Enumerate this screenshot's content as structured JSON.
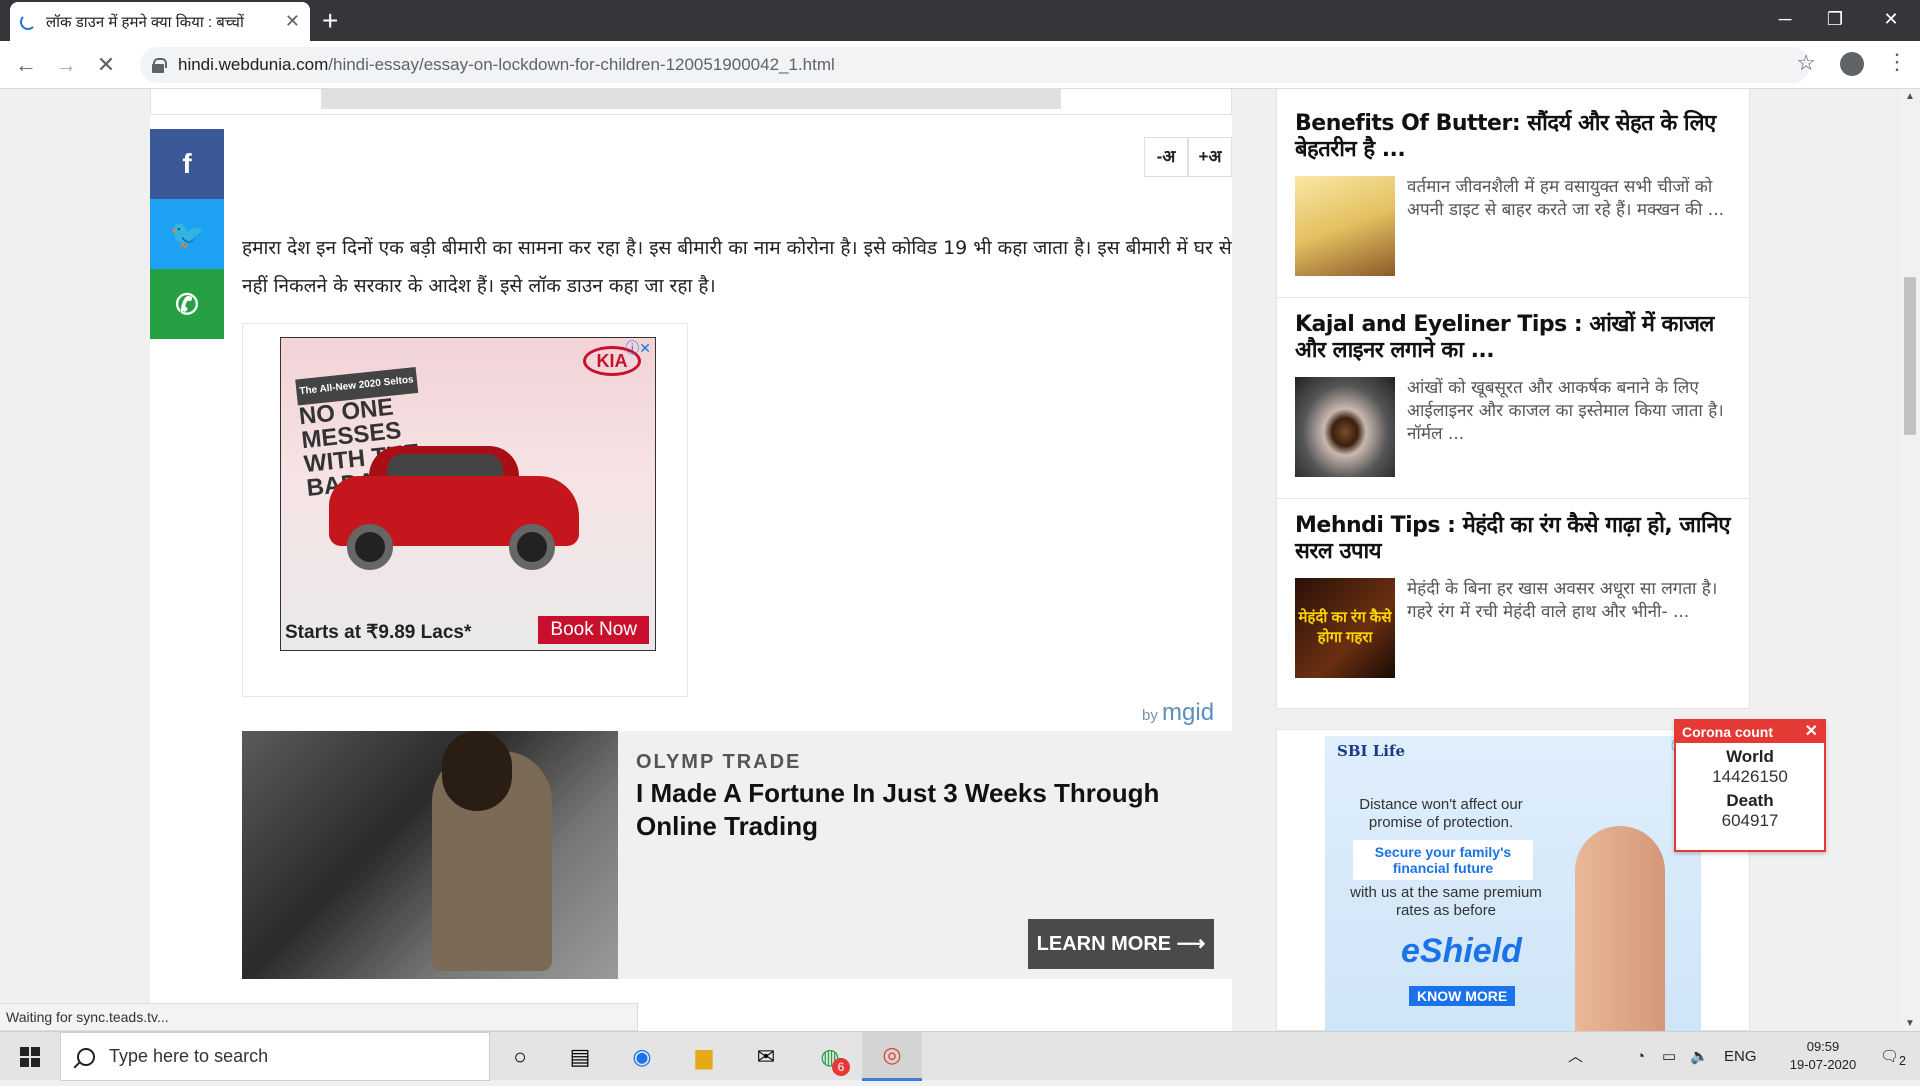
{
  "browser": {
    "tab_title": "लॉक डाउन में हमने क्या किया : बच्चों",
    "tab_close": "✕",
    "new_tab": "+",
    "url_domain": "hindi.webdunia.com",
    "url_path": "/hindi-essay/essay-on-lockdown-for-children-120051900042_1.html",
    "status": "Waiting for sync.teads.tv..."
  },
  "article": {
    "font_decrease": "-अ",
    "font_increase": "+अ",
    "paragraph": "हमारा देश इन दिनों एक बड़ी बीमारी का सामना कर रहा है। इस बीमारी का नाम कोरोना है। इसे कोविड 19 भी कहा जाता है। इस बीमारी में घर से नहीं निकलने के सरकार के आदेश हैं। इसे लॉक डाउन कहा जा रहा है।",
    "share": {
      "facebook": "f",
      "twitter": "🐦",
      "whatsapp": "✆"
    }
  },
  "kia_ad": {
    "tagline": "The All-New 2020 Seltos",
    "headline": "NO ONE MESSES WITH THE BADASS.",
    "logo": "KIA",
    "price": "Starts at ₹9.89 Lacs*",
    "cta": "Book Now",
    "adchoices": "ⓘ✕"
  },
  "native_ad": {
    "by": "by",
    "network": "mgid",
    "brand": "OLYMP TRADE",
    "headline": "I Made A Fortune In Just 3 Weeks Through Online Trading",
    "cta": "LEARN MORE ⟶"
  },
  "sidebar": {
    "cards": [
      {
        "title": "Benefits Of Butter: सौंदर्य और सेहत के लिए बेहतरीन है ...",
        "excerpt": "वर्तमान जीवनशैली में हम वसायुक्त सभी चीजों को अपनी डाइट से बाहर करते जा रहे हैं। मक्खन की ..."
      },
      {
        "title": "Kajal and Eyeliner Tips : आंखों में काजल और लाइनर लगाने का ...",
        "excerpt": "आंखों को खूबसूरत और आकर्षक बनाने के लिए आईलाइनर और काजल का इस्तेमाल किया जाता है। नॉर्मल ..."
      },
      {
        "title": "Mehndi Tips : मेहंदी का रंग कैसे गाढ़ा हो, जानिए सरल उपाय",
        "excerpt": "मेहंदी के बिना हर खास अवसर अधूरा सा लगता है। गहरे रंग में रची मेहंदी वाले हाथ और भीनी- ...",
        "thumb_text": "मेहंदी का रंग कैसे होगा गहरा"
      }
    ]
  },
  "sbi_ad": {
    "logo": "SBI Life",
    "line1": "Distance won't affect our promise of protection.",
    "line2": "Secure your family's financial future",
    "line3": "with us at the same premium rates as before",
    "product": "eShield",
    "cta": "KNOW MORE",
    "adchoices": "ⓘ✕"
  },
  "corona_widget": {
    "title": "Corona count",
    "close": "✕",
    "world_label": "World",
    "world_value": "14426150",
    "death_label": "Death",
    "death_value": "604917"
  },
  "taskbar": {
    "search_placeholder": "Type here to search",
    "whatsapp_badge": "6",
    "language": "ENG",
    "time": "09:59",
    "date": "19-07-2020",
    "notifications": "2"
  }
}
